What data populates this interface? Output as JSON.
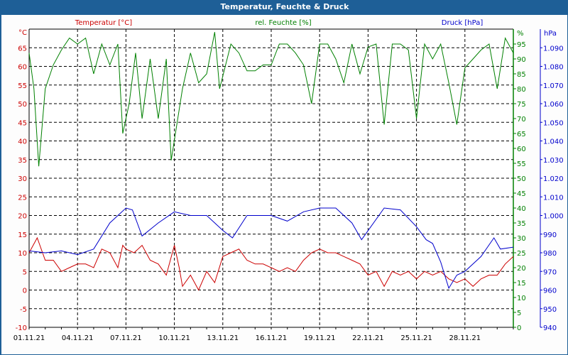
{
  "window": {
    "title": "Temperatur, Feuchte & Druck"
  },
  "chart_data": {
    "type": "line",
    "title": "Temperatur, Feuchte & Druck",
    "x_tick_labels": [
      "01.11.21",
      "04.11.21",
      "07.11.21",
      "10.11.21",
      "13.11.21",
      "16.11.21",
      "19.11.21",
      "22.11.21",
      "25.11.21",
      "28.11.21"
    ],
    "x_unit": "days since 01.11.21",
    "xlim": [
      0,
      30
    ],
    "grid": true,
    "axes": {
      "temperature": {
        "label": "Temperatur [°C]",
        "unit": "°C",
        "ylim": [
          -10,
          70
        ],
        "ticks": [
          -10,
          -5,
          0,
          5,
          10,
          15,
          20,
          25,
          30,
          35,
          40,
          45,
          50,
          55,
          60,
          65
        ],
        "color": "#cc0000",
        "side": "left"
      },
      "humidity": {
        "label": "rel. Feuchte [%]",
        "unit": "%",
        "ylim": [
          0,
          100
        ],
        "ticks": [
          0,
          5,
          10,
          15,
          20,
          25,
          30,
          35,
          40,
          45,
          50,
          55,
          60,
          65,
          70,
          75,
          80,
          85,
          90,
          95
        ],
        "color": "#008000",
        "side": "right"
      },
      "pressure": {
        "label": "Druck [hPa]",
        "unit": "hPa",
        "ylim": [
          940,
          1100
        ],
        "ticks": [
          940,
          950,
          960,
          970,
          980,
          990,
          1000,
          1010,
          1020,
          1030,
          1040,
          1050,
          1060,
          1070,
          1080,
          1090
        ],
        "tick_labels": [
          "940",
          "950",
          "960",
          "970",
          "980",
          "990",
          "1.000",
          "1.010",
          "1.020",
          "1.030",
          "1.040",
          "1.050",
          "1.060",
          "1.070",
          "1.080",
          "1.090"
        ],
        "color": "#0000cc",
        "side": "right-outer"
      }
    },
    "series": [
      {
        "name": "Temperatur",
        "axis": "temperature",
        "color": "#cc0000",
        "points": [
          [
            0,
            10
          ],
          [
            0.5,
            14
          ],
          [
            1,
            8
          ],
          [
            1.5,
            8
          ],
          [
            2,
            5
          ],
          [
            2.5,
            6
          ],
          [
            3,
            7
          ],
          [
            3.5,
            7
          ],
          [
            4,
            6
          ],
          [
            4.5,
            11
          ],
          [
            5,
            10
          ],
          [
            5.5,
            6
          ],
          [
            5.8,
            12
          ],
          [
            6,
            11
          ],
          [
            6.5,
            10
          ],
          [
            7,
            12
          ],
          [
            7.5,
            8
          ],
          [
            8,
            7
          ],
          [
            8.5,
            4
          ],
          [
            9,
            12
          ],
          [
            9.3,
            6
          ],
          [
            9.5,
            1
          ],
          [
            10,
            4
          ],
          [
            10.5,
            0
          ],
          [
            11,
            5
          ],
          [
            11.5,
            2
          ],
          [
            12,
            9
          ],
          [
            12.5,
            10
          ],
          [
            13,
            11
          ],
          [
            13.5,
            8
          ],
          [
            14,
            7
          ],
          [
            14.5,
            7
          ],
          [
            15,
            6
          ],
          [
            15.5,
            5
          ],
          [
            16,
            6
          ],
          [
            16.5,
            5
          ],
          [
            17,
            8
          ],
          [
            17.5,
            10
          ],
          [
            18,
            11
          ],
          [
            18.5,
            10
          ],
          [
            19,
            10
          ],
          [
            19.5,
            9
          ],
          [
            20,
            8
          ],
          [
            20.5,
            7
          ],
          [
            21,
            4
          ],
          [
            21.5,
            5
          ],
          [
            22,
            1
          ],
          [
            22.5,
            5
          ],
          [
            23,
            4
          ],
          [
            23.5,
            5
          ],
          [
            24,
            3
          ],
          [
            24.5,
            5
          ],
          [
            25,
            4
          ],
          [
            25.5,
            5
          ],
          [
            26,
            3
          ],
          [
            26.5,
            2
          ],
          [
            27,
            3
          ],
          [
            27.5,
            1
          ],
          [
            28,
            3
          ],
          [
            28.5,
            4
          ],
          [
            29,
            4
          ],
          [
            29.5,
            7
          ],
          [
            30,
            9
          ]
        ]
      },
      {
        "name": "rel. Feuchte",
        "axis": "humidity",
        "color": "#008000",
        "points": [
          [
            0,
            92
          ],
          [
            0.3,
            80
          ],
          [
            0.6,
            54
          ],
          [
            1,
            80
          ],
          [
            1.5,
            88
          ],
          [
            2,
            93
          ],
          [
            2.5,
            97
          ],
          [
            3,
            95
          ],
          [
            3.5,
            97
          ],
          [
            4,
            85
          ],
          [
            4.5,
            95
          ],
          [
            5,
            88
          ],
          [
            5.5,
            95
          ],
          [
            5.8,
            65
          ],
          [
            6.2,
            75
          ],
          [
            6.6,
            92
          ],
          [
            7,
            70
          ],
          [
            7.5,
            90
          ],
          [
            8,
            70
          ],
          [
            8.5,
            90
          ],
          [
            8.8,
            56
          ],
          [
            9.5,
            80
          ],
          [
            10,
            92
          ],
          [
            10.5,
            82
          ],
          [
            11,
            85
          ],
          [
            11.5,
            99
          ],
          [
            11.8,
            80
          ],
          [
            12.5,
            95
          ],
          [
            13,
            92
          ],
          [
            13.5,
            86
          ],
          [
            14,
            86
          ],
          [
            14.5,
            88
          ],
          [
            15,
            88
          ],
          [
            15.5,
            95
          ],
          [
            16,
            95
          ],
          [
            16.5,
            92
          ],
          [
            17,
            88
          ],
          [
            17.5,
            75
          ],
          [
            18,
            95
          ],
          [
            18.5,
            95
          ],
          [
            19,
            90
          ],
          [
            19.5,
            82
          ],
          [
            20,
            95
          ],
          [
            20.5,
            85
          ],
          [
            21,
            94
          ],
          [
            21.5,
            95
          ],
          [
            22,
            68
          ],
          [
            22.5,
            95
          ],
          [
            23,
            95
          ],
          [
            23.5,
            93
          ],
          [
            24,
            70
          ],
          [
            24.5,
            95
          ],
          [
            25,
            90
          ],
          [
            25.5,
            95
          ],
          [
            26,
            82
          ],
          [
            26.5,
            68
          ],
          [
            27,
            87
          ],
          [
            27.5,
            90
          ],
          [
            28,
            93
          ],
          [
            28.5,
            95
          ],
          [
            29,
            80
          ],
          [
            29.5,
            97
          ],
          [
            30,
            92
          ]
        ]
      },
      {
        "name": "Druck",
        "axis": "pressure",
        "color": "#0000cc",
        "points": [
          [
            0,
            981
          ],
          [
            1,
            980
          ],
          [
            2,
            981
          ],
          [
            3,
            979
          ],
          [
            4,
            982
          ],
          [
            5,
            996
          ],
          [
            6,
            1004
          ],
          [
            6.4,
            1003
          ],
          [
            7,
            989
          ],
          [
            8,
            996
          ],
          [
            9,
            1002
          ],
          [
            10,
            1000
          ],
          [
            11,
            1000
          ],
          [
            12,
            992
          ],
          [
            12.6,
            988
          ],
          [
            13.5,
            1000
          ],
          [
            15,
            1000
          ],
          [
            16,
            997
          ],
          [
            17,
            1002
          ],
          [
            18,
            1004
          ],
          [
            19,
            1004
          ],
          [
            20,
            996
          ],
          [
            20.6,
            987
          ],
          [
            22,
            1004
          ],
          [
            23,
            1003
          ],
          [
            24,
            994
          ],
          [
            24.6,
            987
          ],
          [
            25,
            985
          ],
          [
            25.5,
            975
          ],
          [
            26,
            961
          ],
          [
            26.5,
            968
          ],
          [
            27,
            970
          ],
          [
            28,
            978
          ],
          [
            28.8,
            988
          ],
          [
            29.2,
            982
          ],
          [
            30,
            983
          ]
        ]
      }
    ]
  }
}
